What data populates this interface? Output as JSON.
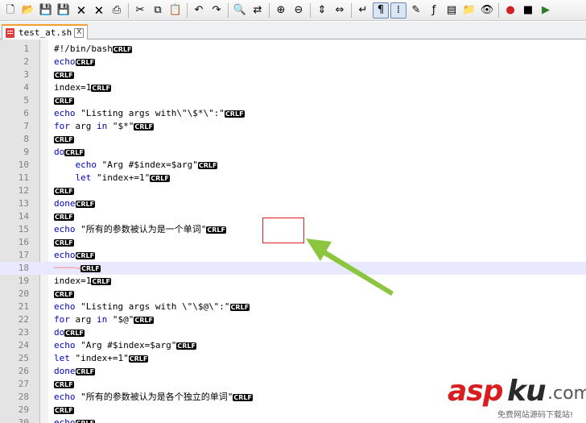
{
  "toolbar": {
    "icons": [
      "new-file-icon",
      "open-file-icon",
      "save-icon",
      "save-all-icon",
      "close-icon",
      "close-all-icon",
      "print-icon",
      "cut-icon",
      "copy-icon",
      "paste-icon",
      "undo-icon",
      "redo-icon",
      "find-icon",
      "replace-icon",
      "zoom-in-icon",
      "zoom-out-icon",
      "sync-vertical-icon",
      "sync-horizontal-icon",
      "word-wrap-icon",
      "show-all-characters-icon",
      "indent-guide-icon",
      "user-language-icon",
      "function-list-icon",
      "doc-map-icon",
      "folder-workspace-icon",
      "monitor-icon",
      "record-macro-icon",
      "stop-macro-icon",
      "play-macro-icon"
    ]
  },
  "tab": {
    "label": "test_at.sh",
    "close": "X"
  },
  "eol": {
    "cr": "CR",
    "lf": "LF"
  },
  "lines": [
    {
      "num": "1",
      "text": "#!/bin/bash"
    },
    {
      "num": "2",
      "text": "echo"
    },
    {
      "num": "3",
      "text": ""
    },
    {
      "num": "4",
      "text": "index=1"
    },
    {
      "num": "5",
      "text": ""
    },
    {
      "num": "6",
      "text": "echo \"Listing args with\\\"\\$*\\\":\""
    },
    {
      "num": "7",
      "text": "for arg in \"$*\""
    },
    {
      "num": "8",
      "text": ""
    },
    {
      "num": "9",
      "text": "do"
    },
    {
      "num": "10",
      "text": "    echo \"Arg #$index=$arg\""
    },
    {
      "num": "11",
      "text": "    let \"index+=1\""
    },
    {
      "num": "12",
      "text": ""
    },
    {
      "num": "13",
      "text": "done"
    },
    {
      "num": "14",
      "text": ""
    },
    {
      "num": "15",
      "text": "echo \"所有的参数被认为是一个单词\""
    },
    {
      "num": "16",
      "text": ""
    },
    {
      "num": "17",
      "text": "echo"
    },
    {
      "num": "18",
      "text": "       "
    },
    {
      "num": "19",
      "text": "index=1"
    },
    {
      "num": "20",
      "text": ""
    },
    {
      "num": "21",
      "text": "echo \"Listing args with \\\"\\$@\\\":\""
    },
    {
      "num": "22",
      "text": "for arg in \"$@\""
    },
    {
      "num": "23",
      "text": "do"
    },
    {
      "num": "24",
      "text": "echo \"Arg #$index=$arg\""
    },
    {
      "num": "25",
      "text": "let \"index+=1\""
    },
    {
      "num": "26",
      "text": "done"
    },
    {
      "num": "27",
      "text": ""
    },
    {
      "num": "28",
      "text": "echo \"所有的参数被认为是各个独立的单词\""
    },
    {
      "num": "29",
      "text": ""
    },
    {
      "num": "30",
      "text": "echo"
    }
  ],
  "current_line": "18",
  "watermark": {
    "brand_a": "asp",
    "brand_b": "ku",
    "brand_c": ".com",
    "subtitle": "免费网站源码下载站!"
  },
  "colors": {
    "keyword": "#0000c0",
    "eol_bg": "#000000",
    "callout": "#e02020",
    "arrow": "#8cc63f",
    "current_line": "#e8e8ff"
  }
}
